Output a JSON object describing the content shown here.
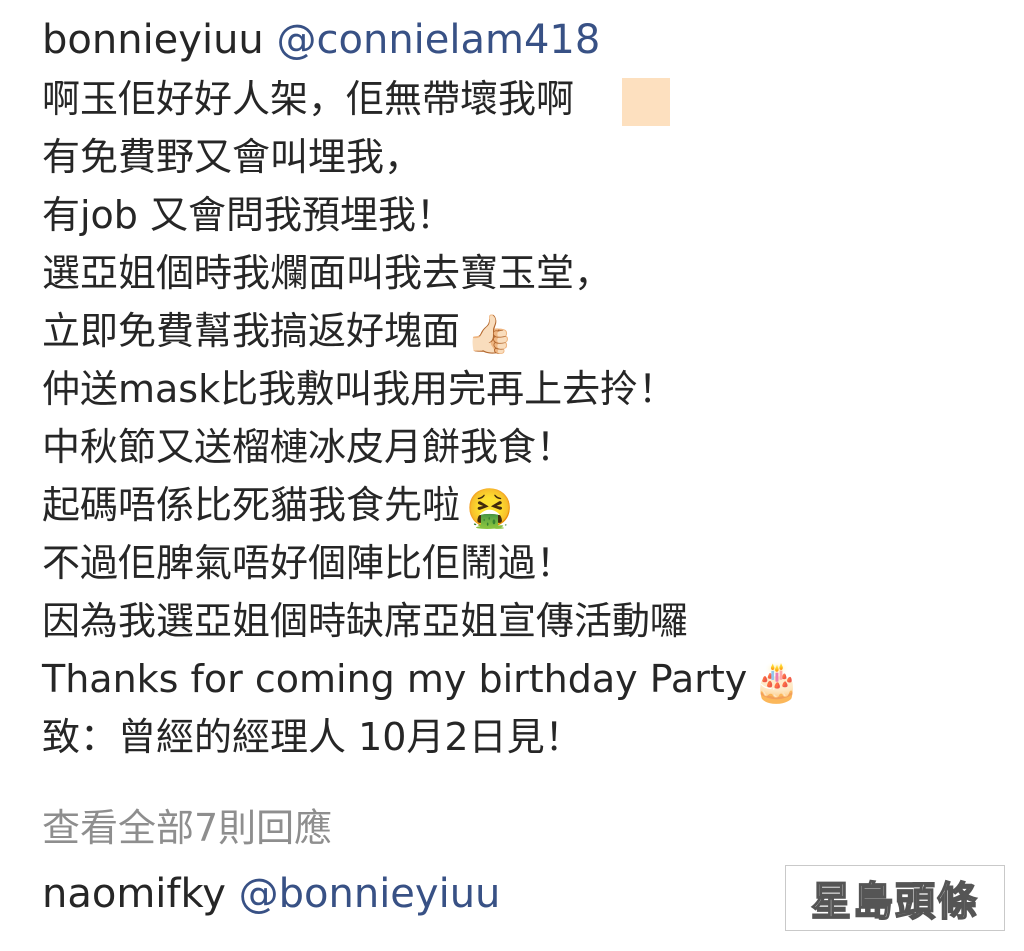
{
  "comment": {
    "username": "bonnieyiuu",
    "mention": "@connielam418",
    "lines": [
      "啊玉佢好好人架，佢無帶壞我啊",
      "有免費野又會叫埋我，",
      "有job 又會問我預埋我！",
      "選亞姐個時我爛面叫我去寶玉堂，",
      "立即免費幫我搞返好塊面",
      "仲送mask比我敷叫我用完再上去拎！",
      "中秋節又送榴槤冰皮月餅我食！",
      "起碼唔係比死貓我食先啦",
      "不過佢脾氣唔好個陣比佢鬧過！",
      "因為我選亞姐個時缺席亞姐宣傳活動囉",
      "Thanks for coming my birthday Party",
      "致：曾經的經理人 10月2日見！"
    ],
    "emoji": {
      "line1": "skin-tone-swatch",
      "line5": "👍🏻",
      "line8": "🤮",
      "line11": "🎂"
    }
  },
  "view_replies": "查看全部7則回應",
  "reply": {
    "username": "naomifky",
    "mention": "@bonnieyiuu"
  },
  "watermark": {
    "text": "星島頭條"
  },
  "colors": {
    "text": "#262626",
    "mention": "#385185",
    "muted": "#8e8e8e"
  }
}
